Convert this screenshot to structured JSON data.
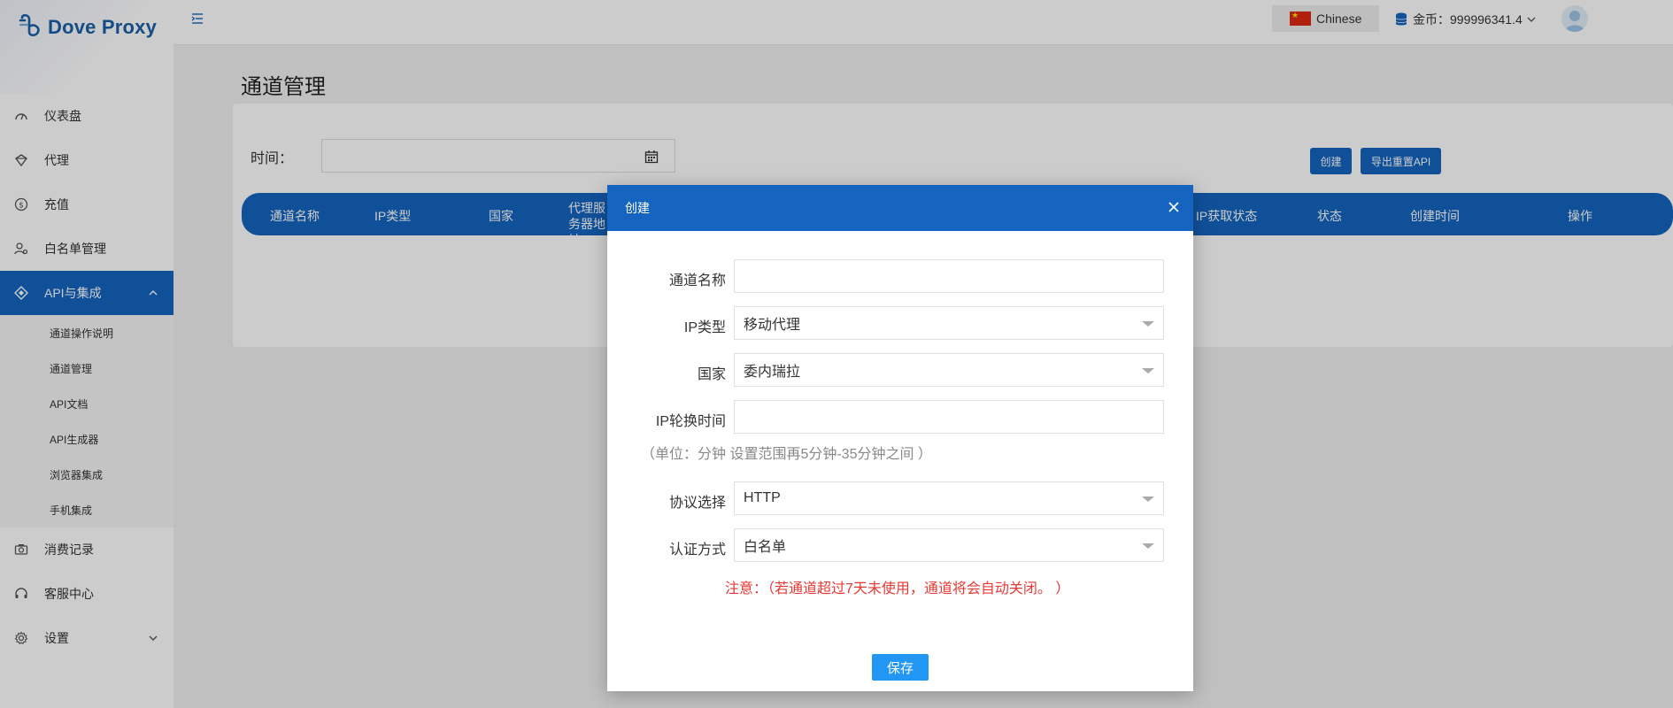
{
  "app": {
    "name": "Dove Proxy"
  },
  "sidebar": {
    "items": [
      {
        "label": "仪表盘",
        "icon": "dashboard-icon"
      },
      {
        "label": "代理",
        "icon": "proxy-icon"
      },
      {
        "label": "充值",
        "icon": "dollar-icon"
      },
      {
        "label": "白名单管理",
        "icon": "user-settings-icon"
      },
      {
        "label": "API与集成",
        "icon": "api-icon",
        "active": true,
        "expanded": true
      },
      {
        "label": "消费记录",
        "icon": "camera-icon"
      },
      {
        "label": "客服中心",
        "icon": "headset-icon"
      },
      {
        "label": "设置",
        "icon": "gear-icon"
      }
    ],
    "sub_items": [
      {
        "label": "通道操作说明"
      },
      {
        "label": "通道管理"
      },
      {
        "label": "API文档"
      },
      {
        "label": "API生成器"
      },
      {
        "label": "浏览器集成"
      },
      {
        "label": "手机集成"
      }
    ]
  },
  "header": {
    "language": "Chinese",
    "coin_label": "金币：",
    "coin_value": "999996341.4"
  },
  "page": {
    "title": "通道管理",
    "filter_time_label": "时间：",
    "create_button": "创建",
    "export_button": "导出重置API",
    "table_columns": [
      "通道名称",
      "IP类型",
      "国家",
      "代理服务器地址",
      "IP获取状态",
      "状态",
      "创建时间",
      "操作"
    ]
  },
  "modal": {
    "title": "创建",
    "fields": {
      "channel_name": {
        "label": "通道名称",
        "value": ""
      },
      "ip_type": {
        "label": "IP类型",
        "value": "移动代理"
      },
      "country": {
        "label": "国家",
        "value": "委内瑞拉"
      },
      "rotation": {
        "label": "IP轮换时间",
        "value": ""
      },
      "protocol": {
        "label": "协议选择",
        "value": "HTTP"
      },
      "auth": {
        "label": "认证方式",
        "value": "白名单"
      }
    },
    "hint": "（单位：分钟 设置范围再5分钟-35分钟之间 ）",
    "note": "注意：（若通道超过7天未使用，通道将会自动关闭。 ）",
    "save_button": "保存"
  }
}
